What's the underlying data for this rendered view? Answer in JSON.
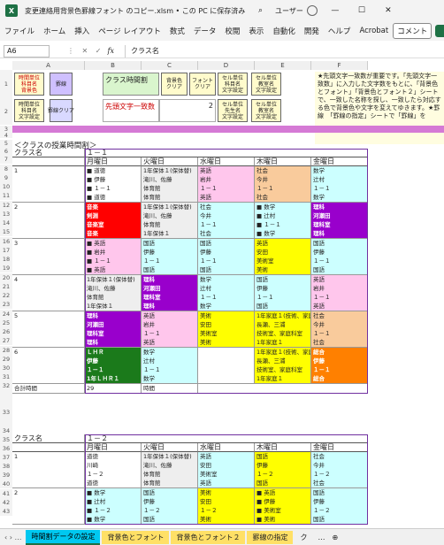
{
  "window": {
    "title": "変更連絡用背景色罫線フォント のコピー.xlsm • この PC に保存済み ∨",
    "user": "ユーザー",
    "min": "—",
    "max": "☐",
    "close": "✕"
  },
  "menu": [
    "ファイル",
    "ホーム",
    "挿入",
    "ページ レイアウト",
    "数式",
    "データ",
    "校閲",
    "表示",
    "自動化",
    "開発",
    "ヘルプ",
    "Acrobat"
  ],
  "menu_right": {
    "comment": "コメント"
  },
  "formula": {
    "cell": "A6",
    "icons": "⋮ ✕ ✓",
    "fx": "fx",
    "value": "クラス名"
  },
  "columns": [
    "A",
    "B",
    "C",
    "D",
    "E",
    "F"
  ],
  "rows": [
    "1",
    "2",
    "3",
    "4",
    "5",
    "6",
    "7",
    "8",
    "9",
    "10",
    "11",
    "12",
    "13",
    "14",
    "15",
    "16",
    "17",
    "18",
    "19",
    "20",
    "21",
    "22",
    "23",
    "24",
    "25",
    "26",
    "27",
    "28",
    "29",
    "30",
    "31",
    "32",
    "33",
    "34",
    "35",
    "36",
    "37",
    "38",
    "39",
    "40",
    "41",
    "42",
    "43"
  ],
  "buttons": {
    "b1": "時間単位\n科目名\n背景色",
    "b2": "罫線",
    "b3": "時間単位\n科目名\n文字設定",
    "b4": "罫線クリア",
    "b5": "背景色\nクリア",
    "b6": "フォント\nクリア",
    "b7": "セル単位\n科目名\n文字設定",
    "b8": "セル単位\n教室名\n文字設定",
    "b9": "セル単位\n先生名\n文字設定",
    "b10": "セル単位\n教室名\n文字設定"
  },
  "ctrl": {
    "label1": "クラス時間割",
    "label2": "先頭文字一致数",
    "num": "2"
  },
  "note": "★先頭文字一致数が重要です。「先頭文字一致数」に入力した文字数をもとに、「背景色とフォント」「背景色とフォント２」シートで、一致した名称を探し、一致したら対応する色で背景色や文字を変えてゆきます。★罫線　「罫線の指定」シートで「罫線」を",
  "section_title": "＜クラスの授業時間割＞",
  "class1": {
    "label": "クラス名",
    "name": "１－１",
    "days": [
      "月曜日",
      "火曜日",
      "水曜日",
      "木曜日",
      "金曜日"
    ],
    "total_label": "合計時間",
    "total_value": "29",
    "total_unit": "時間"
  },
  "class2": {
    "label": "クラス名",
    "name": "１－２",
    "days": [
      "月曜日",
      "火曜日",
      "水曜日",
      "木曜日",
      "金曜日"
    ]
  },
  "periods": [
    "1",
    "2",
    "3",
    "4",
    "5",
    "6"
  ],
  "tabs": {
    "nav": "‹ › …",
    "t1": "時間割データの設定",
    "t2": "背景色とフォント",
    "t3": "背景色とフォント２",
    "t4": "罫線の指定",
    "t5": "ク",
    "more": "…",
    "add": "⊕"
  },
  "colors": {
    "green": "#1e7145",
    "cyan": "#00c8f0",
    "red": "#ff0000",
    "purple": "#9900cc",
    "pink": "#ffc6ec",
    "peach": "#f9cb9c",
    "yellow": "#ffff00",
    "lightcyan": "#ccffff",
    "gray": "#eeeeee",
    "darkgreen": "#1b7a1b",
    "orange": "#ff8000"
  },
  "t1": [
    [
      [
        "■ 道徳",
        "■ 伊藤",
        "■ １－１",
        "■ 道徳"
      ],
      [
        "1年保体１(保体替)",
        "滝川、佐藤",
        "体育館",
        "体育館"
      ],
      [
        "英語",
        "岩井",
        "１－１",
        "英語"
      ],
      [
        "社会",
        "今井",
        "１－１",
        "社会"
      ],
      [
        "数学",
        "辻村",
        "１－１",
        "数学"
      ]
    ],
    [
      [
        "音楽",
        "剣淵",
        "音楽室",
        "音楽"
      ],
      [
        "1年保体１(保体替)",
        "滝川、佐藤",
        "体育館",
        "1年保体１"
      ],
      [
        "社会",
        "今井",
        "１－１",
        "社会"
      ],
      [
        "■ 数学",
        "■ 辻村",
        "■ １－１",
        "■ 数学"
      ],
      [
        "理科",
        "河瀬田",
        "理科室",
        "理科"
      ]
    ],
    [
      [
        "■ 英語",
        "■ 岩井",
        "■ １－１",
        "■ 英語"
      ],
      [
        "国語",
        "伊藤",
        "１－１",
        "国語"
      ],
      [
        "国語",
        "伊藤",
        "１－１",
        "国語"
      ],
      [
        "英語",
        "安田",
        "美術室",
        "美術"
      ],
      [
        "国語",
        "伊藤",
        "１－１",
        "国語"
      ]
    ],
    [
      [
        "1年保体１(保体替)",
        "滝川、佐藤",
        "体育館",
        "1年保体１"
      ],
      [
        "理科",
        "河瀬田",
        "理科室",
        "理科"
      ],
      [
        "数学",
        "辻村",
        "１－１",
        "数学"
      ],
      [
        "国語",
        "伊藤",
        "１－１",
        "国語"
      ],
      [
        "英語",
        "岩井",
        "１－１",
        "英語"
      ]
    ],
    [
      [
        "理科",
        "河瀬田",
        "理科室",
        "理科"
      ],
      [
        "英語",
        "岩井",
        "１－１",
        "英語"
      ],
      [
        "美術",
        "安田",
        "美術室",
        "美術"
      ],
      [
        "1年家庭１(技術、家庭)",
        "長瀬、三浦",
        "技術室、家庭科室",
        "1年家庭１"
      ],
      [
        "社会",
        "今井",
        "１－１",
        "社会"
      ]
    ],
    [
      [
        "ＬＨＲ",
        "伊藤",
        "１－１",
        "1年ＬＨＲ１"
      ],
      [
        "数学",
        "辻村",
        "１－１",
        "数学"
      ],
      [
        "",
        "",
        "",
        ""
      ],
      [
        "1年家庭１(技術、家庭)",
        "長瀬、三浦",
        "技術室、家庭科室",
        "1年家庭１"
      ],
      [
        "総合",
        "伊藤",
        "１－１",
        "総合"
      ]
    ]
  ],
  "t2": [
    [
      [
        "道徳",
        "川崎",
        "１－２",
        "道徳"
      ],
      [
        "1年保体１(保体替)",
        "滝川、佐藤",
        "体育館",
        "体育館"
      ],
      [
        "英語",
        "安田",
        "美術室",
        "英語"
      ],
      [
        "国語",
        "伊藤",
        "１－２",
        "国語"
      ],
      [
        "社会",
        "今井",
        "１－２",
        "社会"
      ]
    ],
    [
      [
        "■ 数学",
        "■ 辻村",
        "■ １－２",
        "■ 数学"
      ],
      [
        "国語",
        "伊藤",
        "１－２",
        "国語"
      ],
      [
        "美術",
        "安田",
        "１－２",
        "美術"
      ],
      [
        "■ 英語",
        "■ 伊藤",
        "■ 美術室",
        "■ 美術"
      ],
      [
        "国語",
        "伊藤",
        "１－２",
        "国語"
      ]
    ]
  ]
}
